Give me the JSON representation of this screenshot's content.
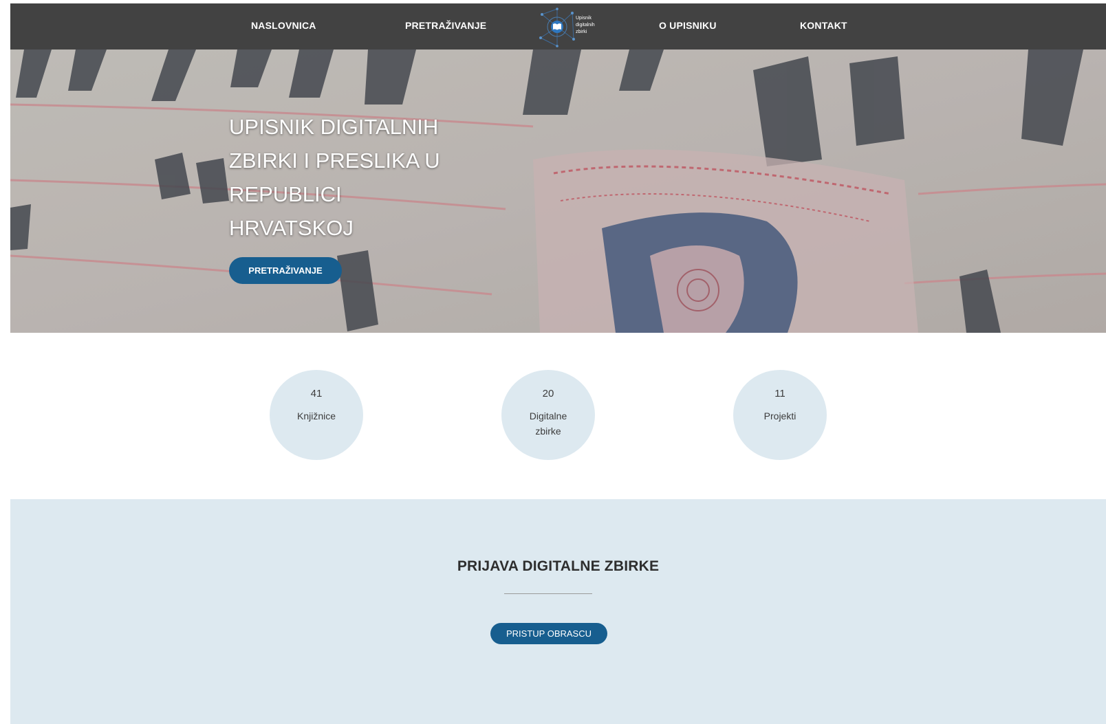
{
  "nav": {
    "items": [
      {
        "label": "NASLOVNICA"
      },
      {
        "label": "PRETRAŽIVANJE"
      },
      {
        "label": "O UPISNIKU"
      },
      {
        "label": "KONTAKT"
      }
    ],
    "logo": {
      "lines": [
        "Upisnik",
        "digitalnih",
        "zbirki"
      ],
      "icon": "open-book-icon"
    }
  },
  "hero": {
    "title_lines": [
      "UPISNIK DIGITALNIH",
      "ZBIRKI I PRESLIKA U",
      "REPUBLICI",
      "HRVATSKOJ"
    ],
    "button_label": "PRETRAŽIVANJE",
    "background": "medieval-manuscript-photo"
  },
  "stats": [
    {
      "value": "41",
      "label": "Knjižnice"
    },
    {
      "value": "20",
      "label": "Digitalne zbirke"
    },
    {
      "value": "11",
      "label": "Projekti"
    }
  ],
  "register": {
    "title": "PRIJAVA DIGITALNE ZBIRKE",
    "button_label": "PRISTUP OBRASCU"
  },
  "colors": {
    "nav_bg": "#424242",
    "accent": "#175e8f",
    "light_blue": "#dde9f0"
  }
}
